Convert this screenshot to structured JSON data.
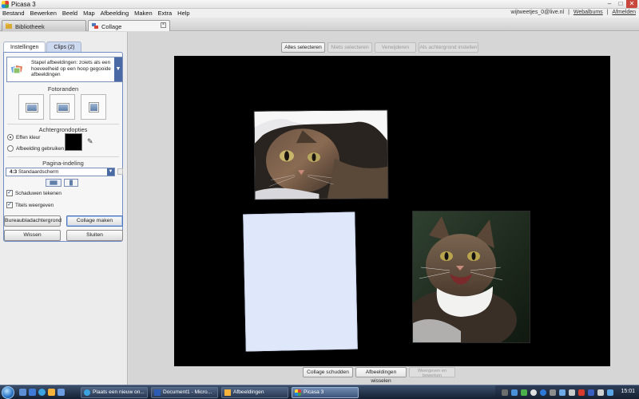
{
  "window": {
    "title": "Picasa 3"
  },
  "menu": {
    "items": [
      "Bestand",
      "Bewerken",
      "Beeld",
      "Map",
      "Afbeelding",
      "Maken",
      "Extra",
      "Help"
    ],
    "account": "wijtweetjes_0@live.nl",
    "sep": "|",
    "web_albums": "Webalbums",
    "logout": "Afmelden"
  },
  "tabs": {
    "library": "Bibliotheek",
    "collage": "Collage",
    "close_icon": "close-icon"
  },
  "left_panel": {
    "tabs": [
      "Instellingen",
      "Clips (2)"
    ],
    "layout_text": "Stapel afbeeldingen: zoiets als een hoeveelheid op een hoop gegooide afbeeldingen",
    "frames_title": "Fotoranden",
    "background_title": "Achtergrondopties",
    "solid_color": "Effen kleur",
    "use_image": "Afbeelding gebruiken",
    "page_layout_title": "Pagina-indeling",
    "page_ratio": "4:3",
    "page_format": "Standaardscherm",
    "draw_shadows": "Schaduwen tekenen",
    "show_captions": "Titels weergeven",
    "btn_desktop": "Bureaubladachtergrond",
    "btn_make": "Collage maken",
    "btn_clear": "Wissen",
    "btn_close": "Sluiten"
  },
  "toolbar": {
    "select_all": "Alles selecteren",
    "select_none": "Niets selecteren",
    "remove": "Verwijderen",
    "set_background": "Als achtergrond instellen"
  },
  "bottom": {
    "shuffle": "Collage schudden",
    "swap": "Afbeeldingen wisselen",
    "disabled_line1": "Weergeven en",
    "disabled_line2": "bewerken"
  },
  "taskbar": {
    "items": [
      "Plaats een nieuw on...",
      "Document1 - Micro...",
      "Afbeeldingen",
      "Picasa 3"
    ],
    "clock": "15:01"
  },
  "colors": {
    "accent": "#4a6aa5",
    "canvas": "#000000",
    "placeholder": "#dfe8fb"
  }
}
